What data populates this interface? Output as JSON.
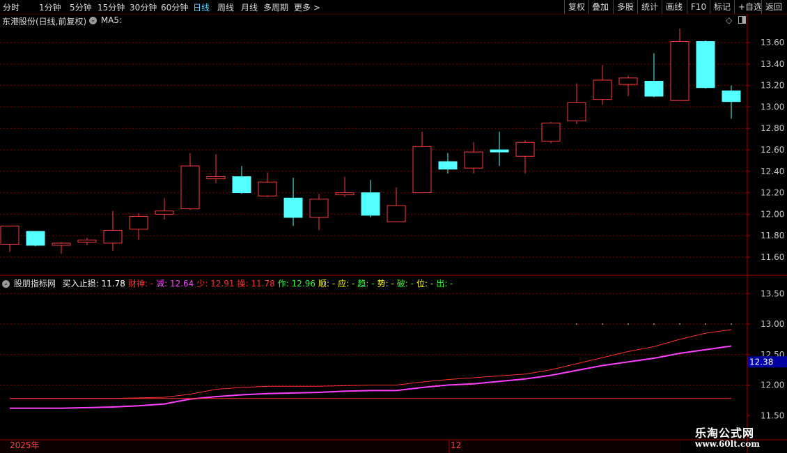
{
  "toolbar": {
    "periods": [
      "分时",
      "1分钟",
      "5分钟",
      "15分钟",
      "30分钟",
      "60分钟",
      "日线",
      "周线",
      "月线",
      "多周期",
      "更多 >"
    ],
    "active_period": "日线",
    "right_buttons": [
      "复权",
      "叠加",
      "多股",
      "统计",
      "画线",
      "F10",
      "标记",
      "+自选",
      "返回"
    ]
  },
  "main_panel": {
    "title": "东港股份(日线,前复权)",
    "ma_label": "MA5:"
  },
  "indicator_panel": {
    "name": "股朋指标网",
    "items": [
      {
        "label": "买入止损: ",
        "value": "11.78",
        "color": "#ffffff"
      },
      {
        "label": "财神: ",
        "value": "-",
        "color": "#ff3030"
      },
      {
        "label": "减: ",
        "value": "12.64",
        "color": "#ff40ff"
      },
      {
        "label": "少: ",
        "value": "12.91",
        "color": "#ff3030"
      },
      {
        "label": "操: ",
        "value": "11.78",
        "color": "#ff3030"
      },
      {
        "label": "作: ",
        "value": "12.96",
        "color": "#30ff30"
      },
      {
        "label": "顺: ",
        "value": "-",
        "color": "#ffff00"
      },
      {
        "label": "应: ",
        "value": "-",
        "color": "#ffff00"
      },
      {
        "label": "趋: ",
        "value": "-",
        "color": "#30ff30"
      },
      {
        "label": "势: ",
        "value": "-",
        "color": "#ffff00"
      },
      {
        "label": "破: ",
        "value": "-",
        "color": "#30ff30"
      },
      {
        "label": "位: ",
        "value": "-",
        "color": "#ffff00"
      },
      {
        "label": "出: ",
        "value": "-",
        "color": "#30ff30"
      }
    ],
    "current_value_badge": "12.38"
  },
  "date_axis": {
    "labels": [
      "2025年",
      "12"
    ]
  },
  "watermark": {
    "title": "乐淘公式网",
    "url": "www.60lt.com"
  },
  "colors": {
    "up": "#ff3c3c",
    "down": "#54ffff",
    "grid": "#8a0000",
    "axis_text": "#c8c8c8",
    "magenta": "#ff30ff",
    "badge_bg": "#0000a0"
  },
  "chart_data": [
    {
      "type": "candlestick",
      "title": "东港股份(日线,前复权)",
      "y_ticks": [
        11.6,
        11.8,
        12.0,
        12.2,
        12.4,
        12.6,
        12.8,
        13.0,
        13.2,
        13.4,
        13.6
      ],
      "ylim": [
        11.45,
        13.75
      ],
      "candles": [
        {
          "o": 11.72,
          "c": 11.89,
          "h": 11.89,
          "l": 11.65
        },
        {
          "o": 11.84,
          "c": 11.71,
          "h": 11.84,
          "l": 11.7
        },
        {
          "o": 11.71,
          "c": 11.73,
          "h": 11.74,
          "l": 11.63
        },
        {
          "o": 11.74,
          "c": 11.76,
          "h": 11.78,
          "l": 11.71
        },
        {
          "o": 11.73,
          "c": 11.85,
          "h": 12.03,
          "l": 11.66
        },
        {
          "o": 11.86,
          "c": 11.98,
          "h": 12.01,
          "l": 11.76
        },
        {
          "o": 12.0,
          "c": 12.03,
          "h": 12.15,
          "l": 11.95
        },
        {
          "o": 12.05,
          "c": 12.45,
          "h": 12.57,
          "l": 12.04
        },
        {
          "o": 12.33,
          "c": 12.35,
          "h": 12.56,
          "l": 12.29
        },
        {
          "o": 12.35,
          "c": 12.2,
          "h": 12.45,
          "l": 12.19
        },
        {
          "o": 12.17,
          "c": 12.3,
          "h": 12.39,
          "l": 12.16
        },
        {
          "o": 12.15,
          "c": 11.97,
          "h": 12.34,
          "l": 11.89
        },
        {
          "o": 11.97,
          "c": 12.14,
          "h": 12.19,
          "l": 11.85
        },
        {
          "o": 12.18,
          "c": 12.2,
          "h": 12.35,
          "l": 12.16
        },
        {
          "o": 12.2,
          "c": 11.99,
          "h": 12.32,
          "l": 11.97
        },
        {
          "o": 11.93,
          "c": 12.08,
          "h": 12.25,
          "l": 11.93
        },
        {
          "o": 12.2,
          "c": 12.63,
          "h": 12.77,
          "l": 12.2
        },
        {
          "o": 12.49,
          "c": 12.42,
          "h": 12.57,
          "l": 12.38
        },
        {
          "o": 12.43,
          "c": 12.58,
          "h": 12.67,
          "l": 12.38
        },
        {
          "o": 12.6,
          "c": 12.58,
          "h": 12.77,
          "l": 12.45
        },
        {
          "o": 12.54,
          "c": 12.67,
          "h": 12.69,
          "l": 12.38
        },
        {
          "o": 12.68,
          "c": 12.85,
          "h": 12.86,
          "l": 12.66
        },
        {
          "o": 12.87,
          "c": 13.04,
          "h": 13.22,
          "l": 12.84
        },
        {
          "o": 13.07,
          "c": 13.25,
          "h": 13.39,
          "l": 13.02
        },
        {
          "o": 13.21,
          "c": 13.27,
          "h": 13.29,
          "l": 13.1
        },
        {
          "o": 13.24,
          "c": 13.1,
          "h": 13.5,
          "l": 13.09
        },
        {
          "o": 13.06,
          "c": 13.61,
          "h": 13.73,
          "l": 13.06
        },
        {
          "o": 13.61,
          "c": 13.18,
          "h": 13.62,
          "l": 13.17
        },
        {
          "o": 13.15,
          "c": 13.05,
          "h": 13.2,
          "l": 12.89
        }
      ]
    },
    {
      "type": "line",
      "title": "股朋指标网",
      "y_ticks": [
        11.5,
        12.0,
        12.5,
        13.0,
        13.5
      ],
      "ylim": [
        11.48,
        13.72
      ],
      "series": [
        {
          "name": "少",
          "color": "#ff3030",
          "values": [
            11.78,
            11.78,
            11.78,
            11.78,
            11.78,
            11.79,
            11.8,
            11.85,
            11.93,
            11.96,
            11.98,
            11.98,
            11.98,
            11.99,
            12.0,
            12.0,
            12.05,
            12.09,
            12.12,
            12.15,
            12.18,
            12.25,
            12.35,
            12.45,
            12.55,
            12.63,
            12.75,
            12.85,
            12.91
          ]
        },
        {
          "name": "减",
          "color": "#ff40ff",
          "values": [
            11.62,
            11.62,
            11.62,
            11.63,
            11.64,
            11.66,
            11.69,
            11.77,
            11.81,
            11.84,
            11.86,
            11.87,
            11.88,
            11.9,
            11.91,
            11.91,
            11.96,
            12.0,
            12.02,
            12.06,
            12.1,
            12.16,
            12.24,
            12.32,
            12.38,
            12.44,
            12.52,
            12.58,
            12.64
          ]
        },
        {
          "name": "操",
          "color": "#ff3030",
          "values": [
            11.78,
            11.78,
            11.78,
            11.78,
            11.78,
            11.78,
            11.78,
            11.78,
            11.78,
            11.78,
            11.78,
            11.78,
            11.78,
            11.78,
            11.78,
            11.78,
            11.78,
            11.78,
            11.78,
            11.78,
            11.78,
            11.78,
            11.78,
            11.78,
            11.78,
            11.78,
            11.78,
            11.78,
            11.78
          ]
        }
      ],
      "dots": [
        null,
        null,
        null,
        null,
        null,
        null,
        null,
        null,
        null,
        null,
        null,
        null,
        null,
        null,
        null,
        null,
        null,
        null,
        null,
        null,
        null,
        null,
        13.0,
        13.0,
        13.0,
        13.0,
        13.0,
        13.0,
        13.0
      ]
    }
  ]
}
